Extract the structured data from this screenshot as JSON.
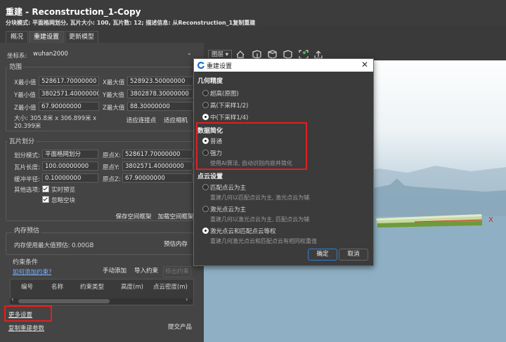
{
  "app": {
    "title": "重建 - Reconstruction_1-Copy",
    "subtitle": "分块模式: 平面格网划分, 瓦片大小: 100, 瓦片数: 12; 描述信息: 从Reconstruction_1复制重建"
  },
  "tabs": [
    {
      "label": "概况",
      "active": false
    },
    {
      "label": "重建设置",
      "active": true
    },
    {
      "label": "更新模型",
      "active": false
    }
  ],
  "crs": {
    "label": "坐标系:",
    "value": "wuhan2000"
  },
  "extent": {
    "title": "范围",
    "x_min_label": "X最小值",
    "x_min": "528617.70000000",
    "x_max_label": "X最大值",
    "x_max": "528923.50000000",
    "y_min_label": "Y最小值",
    "y_min": "3802571.40000000",
    "y_max_label": "Y最大值",
    "y_max": "3802878.30000000",
    "z_min_label": "Z最小值",
    "z_min": "67.90000000",
    "z_max_label": "Z最大值",
    "z_max": "88.30000000",
    "size_line1": "大小: 305.8米 x 306.899米 x",
    "size_line2": "20.399米",
    "fit_tie_points": "适应连接点",
    "fit_cameras": "适应相机"
  },
  "tiling": {
    "title": "瓦片划分",
    "mode_label": "划分模式:",
    "mode_value": "平面格网划分",
    "origin_x_label": "原点X:",
    "origin_x": "528617.70000000",
    "tile_len_label": "瓦片长度:",
    "tile_len": "100.00000000",
    "origin_y_label": "原点Y:",
    "origin_y": "3802571.40000000",
    "buffer_label": "缓冲半径:",
    "buffer": "0.10000000",
    "origin_z_label": "原点Z:",
    "origin_z": "67.90000000",
    "other_label": "其他选项:",
    "realtime_preview": "实时预览",
    "ignore_empty": "忽略空块",
    "save_frame": "保存空间框架",
    "load_frame": "加载空间框架"
  },
  "memory": {
    "title": "内存预估",
    "text": "内存使用最大值预估: 0.00GB",
    "estimate_button": "预估内存"
  },
  "constraints": {
    "title": "约束条件",
    "help_link": "如何添加约束?",
    "manual_add": "手动添加",
    "import": "导入约束",
    "remove": "移出约束",
    "columns": [
      "编号",
      "名称",
      "约束类型",
      "高度(m)",
      "点云密度(m)"
    ]
  },
  "bottom": {
    "more_settings": "更多设置",
    "copy_params": "复制重建参数",
    "submit": "提交产品"
  },
  "viewport": {
    "layers_label": "图层",
    "axis_label": "X",
    "toolbar_icons": [
      "home-icon",
      "cube-front-icon",
      "cube-side-icon",
      "cube-top-icon",
      "scan-icon",
      "share-icon"
    ]
  },
  "dialog": {
    "title": "重建设置",
    "geo_precision": {
      "title": "几何精度",
      "options": [
        "超高(原图)",
        "高(下采样1/2)",
        "中(下采样1/4)"
      ],
      "selected": 2
    },
    "data_simplify": {
      "title": "数据简化",
      "options": [
        "普通",
        "强力"
      ],
      "selected": 0,
      "desc": "使用AI算法, 自动识别内容并简化"
    },
    "point_cloud": {
      "title": "点云设置",
      "options": [
        "匹配点云为主",
        "激光点云为主",
        "激光点云和匹配点云等权"
      ],
      "descs": [
        "重建几何以匹配点云为主, 激光点云为辅",
        "重建几何以激光点云为主, 匹配点云为辅",
        "重建几何激光点云和匹配点云有相同权重值"
      ],
      "selected": 2
    },
    "ok": "确定",
    "cancel": "取消"
  },
  "colors": {
    "highlight": "#e02020",
    "accent": "#2f7fd8"
  }
}
